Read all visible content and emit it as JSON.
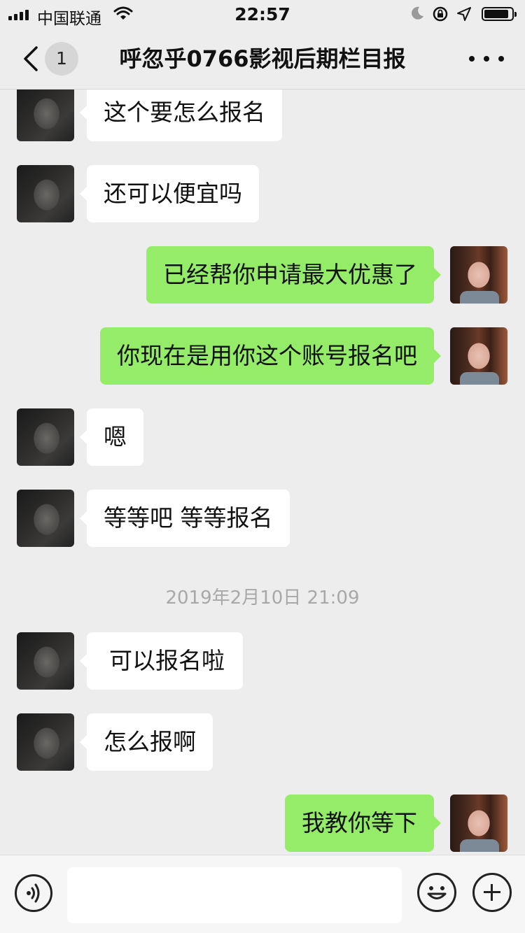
{
  "status_bar": {
    "carrier": "中国联通",
    "time": "22:57",
    "battery_level": 0.9
  },
  "nav": {
    "unread_count": "1",
    "title": "呼忽乎0766影视后期栏目报"
  },
  "messages": [
    {
      "side": "left",
      "text": "这个要怎么报名"
    },
    {
      "side": "left",
      "text": "还可以便宜吗"
    },
    {
      "side": "right",
      "text": "已经帮你申请最大优惠了"
    },
    {
      "side": "right",
      "text": "你现在是用你这个账号报名吧"
    },
    {
      "side": "left",
      "text": "嗯"
    },
    {
      "side": "left",
      "text": "等等吧 等等报名"
    },
    {
      "side": "left",
      "text": "可以报名啦"
    },
    {
      "side": "left",
      "text": "怎么报啊"
    },
    {
      "side": "right",
      "text": "我教你等下"
    }
  ],
  "timestamp": "2019年2月10日 21:09",
  "input_bar": {
    "value": ""
  },
  "icons": {
    "back": "chevron-left-icon",
    "more": "more-dots-icon",
    "voice": "voice-icon",
    "emoji": "emoji-icon",
    "plus": "plus-icon"
  },
  "colors": {
    "background": "#ededed",
    "bubble_self": "#95ec69",
    "bubble_other": "#ffffff",
    "timestamp": "#a8a8a8"
  }
}
